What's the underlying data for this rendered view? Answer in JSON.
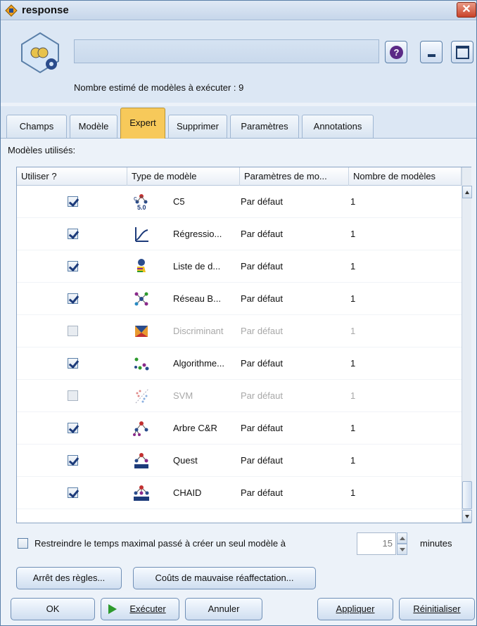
{
  "window": {
    "title": "response",
    "close_glyph": "✕"
  },
  "header": {
    "name_value": "",
    "estimate_text": "Nombre estimé de modèles à exécuter : 9",
    "help_glyph": "?"
  },
  "tabs": [
    {
      "label": "Champs"
    },
    {
      "label": "Modèle"
    },
    {
      "label": "Expert",
      "active": true
    },
    {
      "label": "Supprimer"
    },
    {
      "label": "Paramètres"
    },
    {
      "label": "Annotations"
    }
  ],
  "section": {
    "label": "Modèles utilisés:"
  },
  "table": {
    "headers": [
      "Utiliser ?",
      "Type de modèle",
      "Paramètres de mo...",
      "Nombre de modèles"
    ],
    "rows": [
      {
        "checked": true,
        "enabled": true,
        "icon": "c5-icon",
        "name": "C5",
        "params": "Par défaut",
        "count": "1"
      },
      {
        "checked": true,
        "enabled": true,
        "icon": "regression-icon",
        "name": "Régressio...",
        "params": "Par défaut",
        "count": "1"
      },
      {
        "checked": true,
        "enabled": true,
        "icon": "decision-list-icon",
        "name": "Liste de d...",
        "params": "Par défaut",
        "count": "1"
      },
      {
        "checked": true,
        "enabled": true,
        "icon": "bayes-net-icon",
        "name": "Réseau B...",
        "params": "Par défaut",
        "count": "1"
      },
      {
        "checked": false,
        "enabled": false,
        "icon": "discriminant-icon",
        "name": "Discriminant",
        "params": "Par défaut",
        "count": "1"
      },
      {
        "checked": true,
        "enabled": true,
        "icon": "knn-icon",
        "name": "Algorithme...",
        "params": "Par défaut",
        "count": "1"
      },
      {
        "checked": false,
        "enabled": false,
        "icon": "svm-icon",
        "name": "SVM",
        "params": "Par défaut",
        "count": "1"
      },
      {
        "checked": true,
        "enabled": true,
        "icon": "cart-tree-icon",
        "name": "Arbre C&R",
        "params": "Par défaut",
        "count": "1"
      },
      {
        "checked": true,
        "enabled": true,
        "icon": "quest-icon",
        "name": "Quest",
        "params": "Par défaut",
        "count": "1"
      },
      {
        "checked": true,
        "enabled": true,
        "icon": "chaid-icon",
        "name": "CHAID",
        "params": "Par défaut",
        "count": "1"
      }
    ]
  },
  "restrict": {
    "label": "Restreindre le temps maximal passé à créer un seul modèle à",
    "value": "15",
    "unit": "minutes",
    "checked": false
  },
  "buttons": {
    "stop_rules": "Arrêt des règles...",
    "misclassification": "Coûts de mauvaise réaffectation...",
    "ok": "OK",
    "run": "Exécuter",
    "cancel": "Annuler",
    "apply": "Appliquer",
    "reset": "Réinitialiser"
  },
  "colors": {
    "active_tab": "#f7c95a",
    "close_button": "#c9432a",
    "run_icon": "#2d9a2d"
  }
}
